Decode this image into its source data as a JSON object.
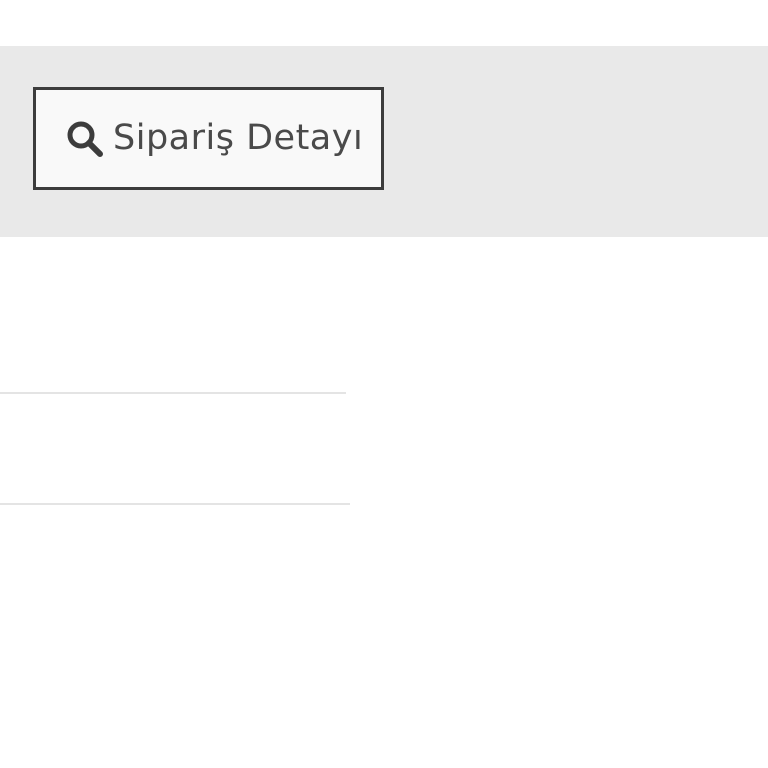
{
  "toolbar": {
    "order_detail_button": {
      "label": "Sipariş Detayı",
      "icon": "search-icon"
    }
  },
  "colors": {
    "toolbar_background": "#e9e9e9",
    "button_border": "#3c3c3c",
    "button_background": "#f9f9f9",
    "text": "#4a4a4a",
    "divider": "#e4e4e4"
  }
}
